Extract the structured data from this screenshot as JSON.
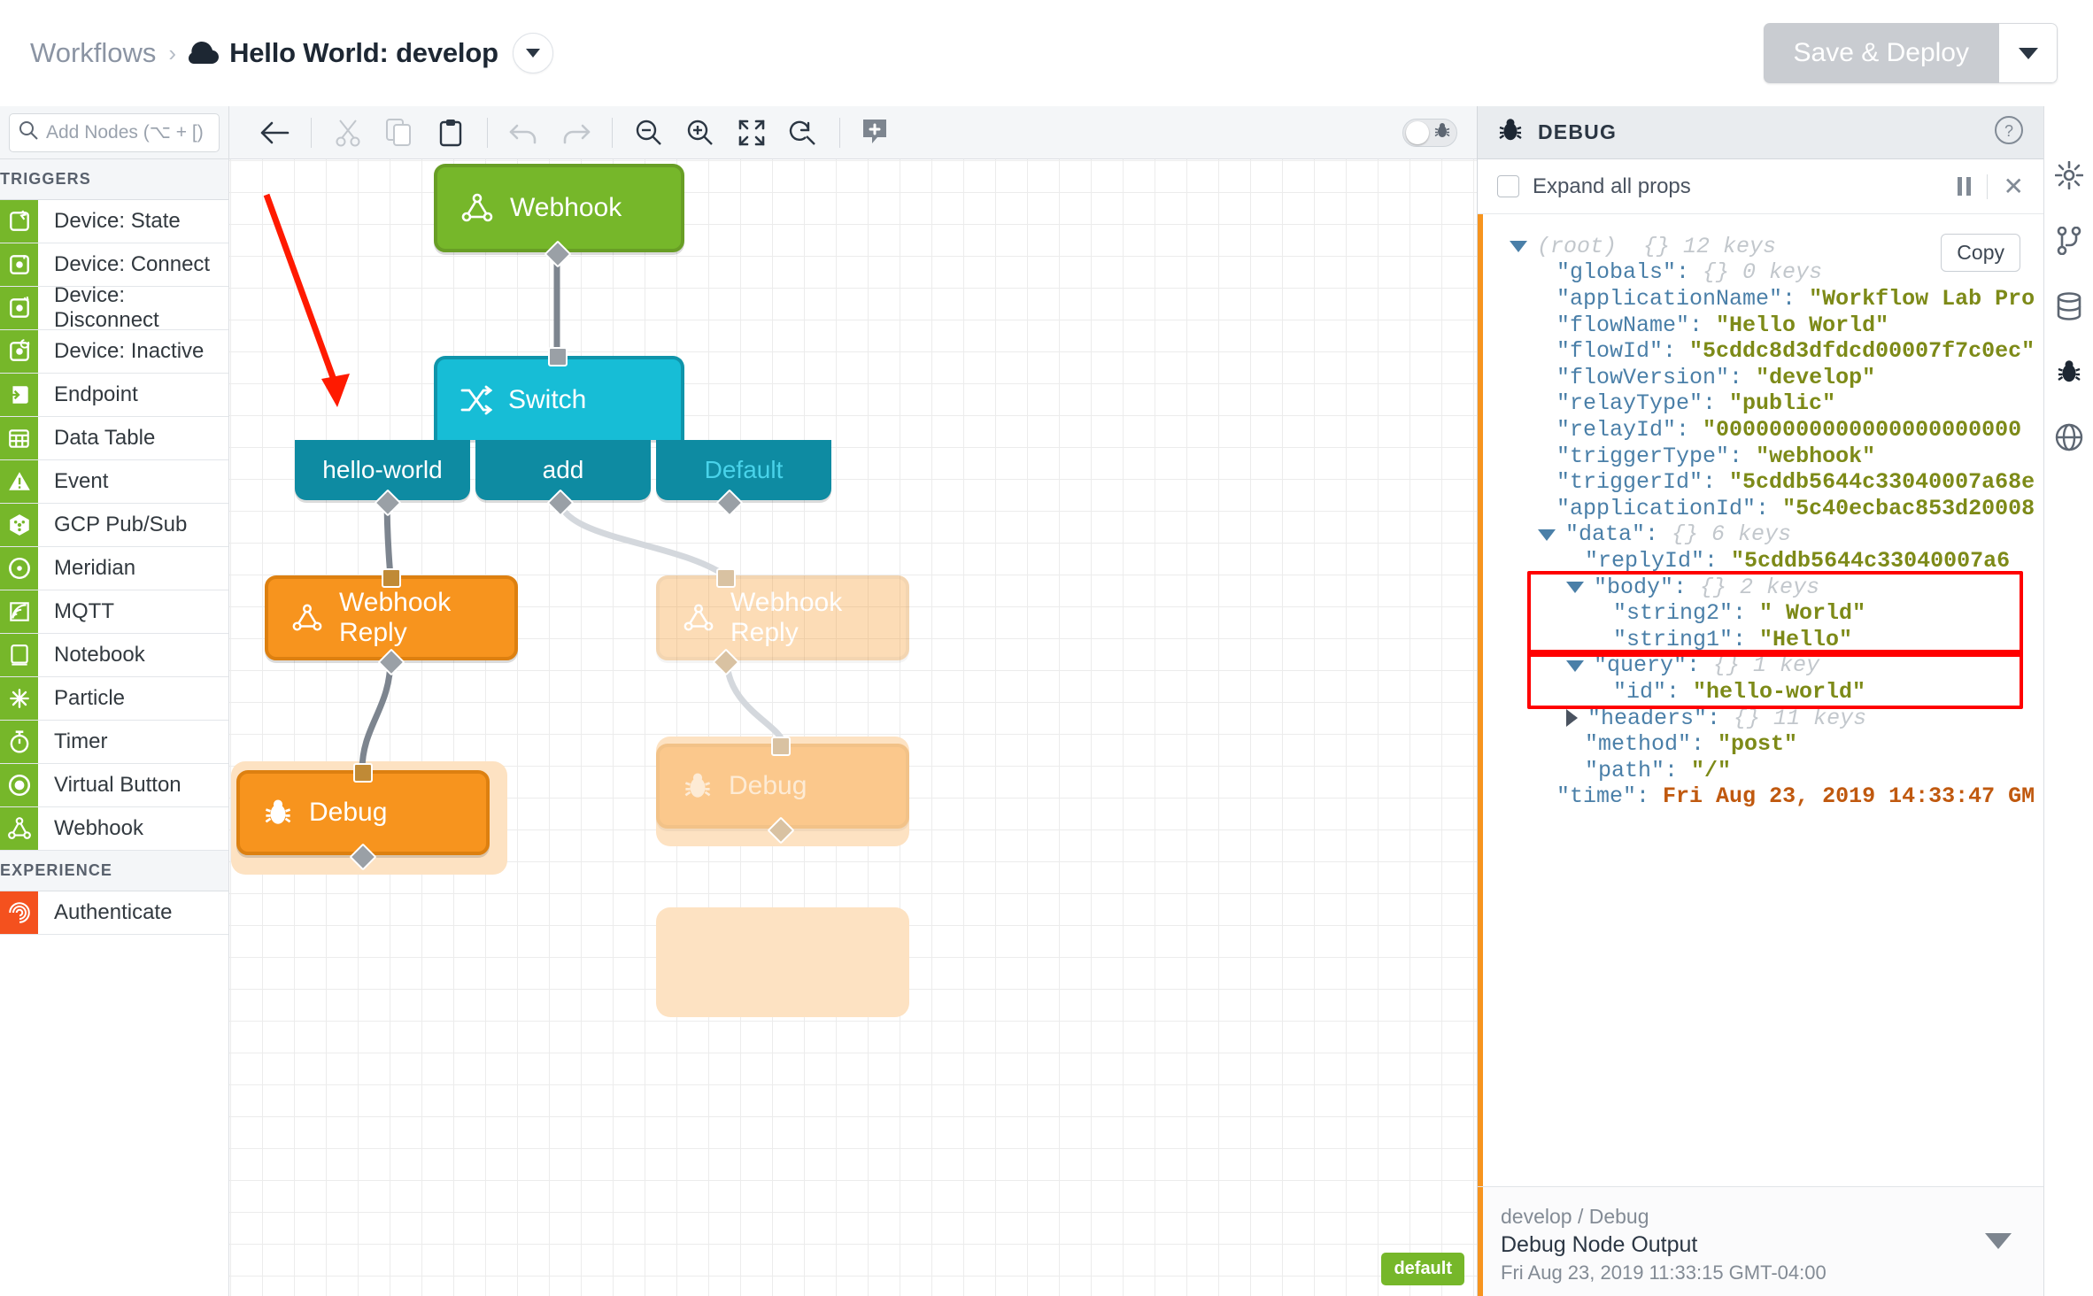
{
  "header": {
    "breadcrumb_root": "Workflows",
    "breadcrumb_sep": "›",
    "breadcrumb_current": "Hello World: develop",
    "cloud_icon": "cloud-icon",
    "caret_icon": "chevron-down-icon",
    "save_button": "Save & Deploy",
    "save_caret_icon": "chevron-down-icon"
  },
  "sidebar": {
    "search_placeholder": "Add Nodes (⌥ + [)",
    "search_icon": "search-icon",
    "sections": [
      {
        "title": "TRIGGERS",
        "items": [
          {
            "label": "Device: State",
            "icon": "device-state-icon"
          },
          {
            "label": "Device: Connect",
            "icon": "device-connect-icon"
          },
          {
            "label": "Device: Disconnect",
            "icon": "device-disconnect-icon"
          },
          {
            "label": "Device: Inactive",
            "icon": "device-inactive-icon"
          },
          {
            "label": "Endpoint",
            "icon": "endpoint-icon"
          },
          {
            "label": "Data Table",
            "icon": "data-table-icon"
          },
          {
            "label": "Event",
            "icon": "event-icon"
          },
          {
            "label": "GCP Pub/Sub",
            "icon": "gcp-pubsub-icon"
          },
          {
            "label": "Meridian",
            "icon": "meridian-icon"
          },
          {
            "label": "MQTT",
            "icon": "mqtt-icon"
          },
          {
            "label": "Notebook",
            "icon": "notebook-icon"
          },
          {
            "label": "Particle",
            "icon": "particle-icon"
          },
          {
            "label": "Timer",
            "icon": "timer-icon"
          },
          {
            "label": "Virtual Button",
            "icon": "virtual-button-icon"
          },
          {
            "label": "Webhook",
            "icon": "webhook-icon"
          }
        ]
      },
      {
        "title": "EXPERIENCE",
        "items": [
          {
            "label": "Authenticate",
            "icon": "fingerprint-icon"
          }
        ]
      }
    ]
  },
  "toolbar": {
    "buttons": [
      {
        "name": "back-button",
        "icon": "arrow-left-icon",
        "disabled": false
      },
      {
        "name": "cut-button",
        "icon": "scissors-icon",
        "disabled": true
      },
      {
        "name": "copy-button",
        "icon": "copy-icon",
        "disabled": true
      },
      {
        "name": "paste-button",
        "icon": "clipboard-icon",
        "disabled": false
      },
      {
        "name": "undo-button",
        "icon": "undo-icon",
        "disabled": true
      },
      {
        "name": "redo-button",
        "icon": "redo-icon",
        "disabled": true
      },
      {
        "name": "zoom-out-button",
        "icon": "zoom-out-icon",
        "disabled": false
      },
      {
        "name": "zoom-in-button",
        "icon": "zoom-in-icon",
        "disabled": false
      },
      {
        "name": "fit-view-button",
        "icon": "expand-icon",
        "disabled": false
      },
      {
        "name": "reset-zoom-button",
        "icon": "zoom-reset-icon",
        "disabled": false
      },
      {
        "name": "add-comment-button",
        "icon": "comment-plus-icon",
        "disabled": false
      }
    ],
    "debug_toggle": {
      "name": "debug-toggle",
      "icon": "bug-icon",
      "on": false
    }
  },
  "canvas": {
    "nodes": [
      {
        "id": "webhook",
        "label": "Webhook",
        "icon": "webhook-icon",
        "kind": "trigger"
      },
      {
        "id": "switch",
        "label": "Switch",
        "icon": "switch-icon",
        "kind": "switch"
      },
      {
        "id": "webhook-reply",
        "label": "Webhook Reply",
        "icon": "webhook-icon",
        "kind": "output"
      },
      {
        "id": "webhook-reply-2",
        "label": "Webhook Reply",
        "icon": "webhook-icon",
        "kind": "output"
      },
      {
        "id": "debug",
        "label": "Debug",
        "icon": "bug-icon",
        "kind": "output"
      },
      {
        "id": "debug-2",
        "label": "Debug",
        "icon": "bug-icon",
        "kind": "output"
      }
    ],
    "switch_branches": [
      {
        "label": "hello-world",
        "active": true
      },
      {
        "label": "add",
        "active": true
      },
      {
        "label": "Default",
        "active": false
      }
    ],
    "badge": "default",
    "annotation_arrow": "red-arrow-annotation"
  },
  "debug": {
    "panel_title": "DEBUG",
    "bug_icon": "bug-icon",
    "help_icon": "help-circle-icon",
    "expand_all_label": "Expand all props",
    "pause_icon": "pause-icon",
    "close_icon": "close-icon",
    "copy_label": "Copy",
    "tree": [
      {
        "indent": 0,
        "toggle": "down",
        "key": "(root)",
        "meta": "{}  12 keys",
        "root": true
      },
      {
        "indent": 1,
        "toggle": "none",
        "key": "\"globals\":",
        "meta": "{}  0 keys"
      },
      {
        "indent": 1,
        "toggle": "none",
        "key": "\"applicationName\":",
        "value": "\"Workflow Lab Pro"
      },
      {
        "indent": 1,
        "toggle": "none",
        "key": "\"flowName\":",
        "value": "\"Hello World\""
      },
      {
        "indent": 1,
        "toggle": "none",
        "key": "\"flowId\":",
        "value": "\"5cddc8d3dfdcd00007f7c0ec\""
      },
      {
        "indent": 1,
        "toggle": "none",
        "key": "\"flowVersion\":",
        "value": "\"develop\""
      },
      {
        "indent": 1,
        "toggle": "none",
        "key": "\"relayType\":",
        "value": "\"public\""
      },
      {
        "indent": 1,
        "toggle": "none",
        "key": "\"relayId\":",
        "value": "\"00000000000000000000000"
      },
      {
        "indent": 1,
        "toggle": "none",
        "key": "\"triggerType\":",
        "value": "\"webhook\""
      },
      {
        "indent": 1,
        "toggle": "none",
        "key": "\"triggerId\":",
        "value": "\"5cddb5644c33040007a68e"
      },
      {
        "indent": 1,
        "toggle": "none",
        "key": "\"applicationId\":",
        "value": "\"5c40ecbac853d20008"
      },
      {
        "indent": 1,
        "toggle": "down",
        "key": "\"data\":",
        "meta": "{}  6 keys"
      },
      {
        "indent": 2,
        "toggle": "none",
        "key": "\"replyId\":",
        "value": "\"5cddb5644c33040007a6"
      },
      {
        "indent": 2,
        "toggle": "down",
        "key": "\"body\":",
        "meta": "{}  2 keys",
        "box": "body-start"
      },
      {
        "indent": 3,
        "toggle": "none",
        "key": "\"string2\":",
        "value": "\" World\""
      },
      {
        "indent": 3,
        "toggle": "none",
        "key": "\"string1\":",
        "value": "\"Hello\"",
        "box": "body-end"
      },
      {
        "indent": 2,
        "toggle": "down",
        "key": "\"query\":",
        "meta": "{}  1 key",
        "box": "query-start"
      },
      {
        "indent": 3,
        "toggle": "none",
        "key": "\"id\":",
        "value": "\"hello-world\"",
        "box": "query-end"
      },
      {
        "indent": 2,
        "toggle": "right",
        "key": "\"headers\":",
        "meta": "{}  11 keys"
      },
      {
        "indent": 2,
        "toggle": "none",
        "key": "\"method\":",
        "value": "\"post\""
      },
      {
        "indent": 2,
        "toggle": "none",
        "key": "\"path\":",
        "value": "\"/\""
      },
      {
        "indent": 1,
        "toggle": "none",
        "key": "\"time\":",
        "time": "Fri Aug 23, 2019 14:33:47 GM"
      }
    ],
    "footer": {
      "path": "develop / Debug",
      "title": "Debug Node Output",
      "timestamp": "Fri Aug 23, 2019 11:33:15 GMT-04:00",
      "caret_icon": "chevron-down-icon"
    }
  },
  "rail": {
    "items": [
      {
        "name": "settings",
        "icon": "gear-icon",
        "active": false
      },
      {
        "name": "versions",
        "icon": "branch-icon",
        "active": false
      },
      {
        "name": "storage",
        "icon": "database-icon",
        "active": false
      },
      {
        "name": "debug",
        "icon": "bug-icon",
        "active": true
      },
      {
        "name": "globals",
        "icon": "globe-icon",
        "active": false
      }
    ]
  },
  "colors": {
    "trigger_green": "#76b72a",
    "switch_cyan": "#17bdd6",
    "switch_dark": "#0e8ba2",
    "output_orange": "#f7941e",
    "annotation_red": "#ff0000",
    "experience_orange": "#f4511e"
  }
}
